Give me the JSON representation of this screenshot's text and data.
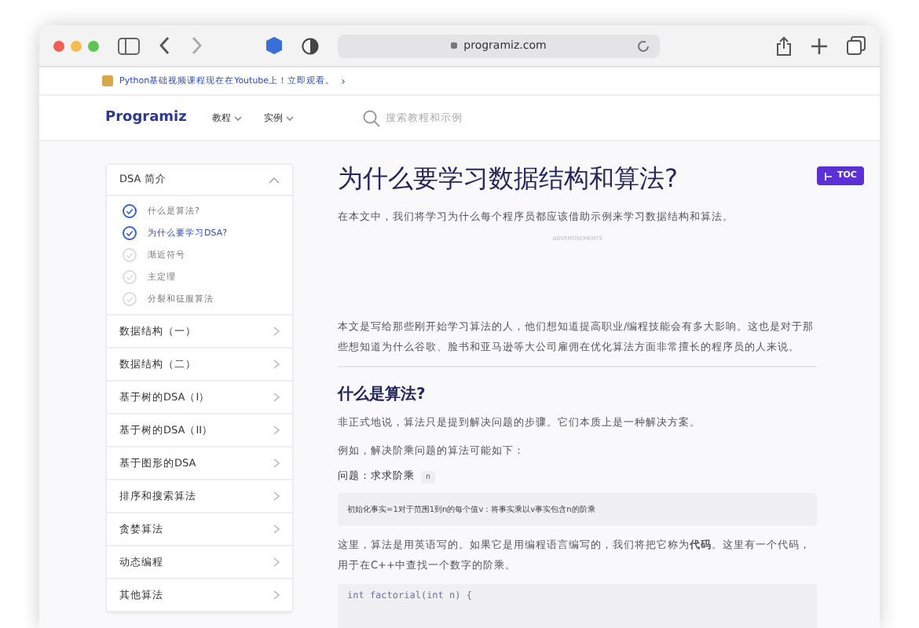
{
  "browser": {
    "address": "programiz.com"
  },
  "banner": {
    "text": "Python基础视频课程现在在Youtube上！立即观看。",
    "arrow": "›"
  },
  "nav": {
    "logo": "Programiz",
    "menus": [
      {
        "label": "教程"
      },
      {
        "label": "实例"
      }
    ],
    "search": {
      "placeholder": "搜索教程和示例"
    }
  },
  "sidebar": {
    "section": {
      "title": "DSA 简介",
      "expanded": true,
      "steps": [
        {
          "label": "什么是算法?",
          "done": true,
          "selected": false
        },
        {
          "label": "为什么要学习DSA?",
          "done": true,
          "selected": true
        },
        {
          "label": "渐近符号",
          "done": false,
          "selected": false
        },
        {
          "label": "主定理",
          "done": false,
          "selected": false
        },
        {
          "label": "分裂和征服算法",
          "done": false,
          "selected": false
        }
      ]
    },
    "items": [
      "数据结构（一）",
      "数据结构（二）",
      "基于树的DSA（I）",
      "基于树的DSA（II）",
      "基于图形的DSA",
      "排序和搜索算法",
      "贪婪算法",
      "动态编程",
      "其他算法"
    ]
  },
  "article": {
    "title": "为什么要学习数据结构和算法?",
    "intro": "在本文中，我们将学习为什么每个程序员都应该借助示例来学习数据结构和算法。",
    "ad_label": "ADVERTISEMENTS",
    "para1": "本文是写给那些刚开始学习算法的人，他们想知道提高职业/编程技能会有多大影响。这也是对于那些想知道为什么谷歌、脸书和亚马逊等大公司雇佣在优化算法方面非常擅长的程序员的人来说。",
    "heading": "什么是算法?",
    "para2": "非正式地说，算法只是提到解决问题的步骤。它们本质上是一种解决方案。",
    "para3": "例如，解决阶乘问题的算法可能如下：",
    "problem": {
      "label": "问题：求求阶乘",
      "code": "n"
    },
    "algo": "初始化事实=1对于范围1到n的每个值v：将事实乘以v事实包含n的阶乘",
    "para4": "这里，算法是用英语写的。如果它是用编程语言编写的，我们将把它称为**代码**。这里有一个代码，用于在C++中查找一个数字的阶乘。",
    "code": "int factorial(int n) {"
  },
  "toc": {
    "label": "TOC"
  }
}
